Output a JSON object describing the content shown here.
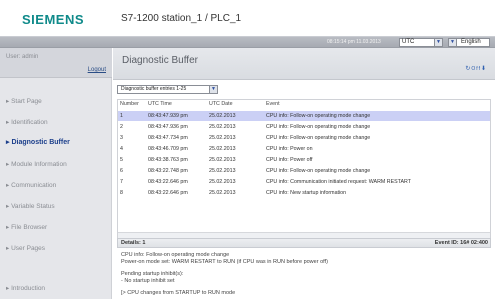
{
  "header": {
    "logo": "SIEMENS",
    "station": "S7-1200 station_1 / PLC_1"
  },
  "topbar": {
    "clock": "08:15:14 pm  11.03.2013",
    "timezone": "UTC",
    "language": "English"
  },
  "sidebar": {
    "user": "User: admin",
    "logout": "Logout",
    "items": [
      {
        "label": "Start Page"
      },
      {
        "label": "Identification"
      },
      {
        "label": "Diagnostic Buffer",
        "active": true
      },
      {
        "label": "Module Information"
      },
      {
        "label": "Communication"
      },
      {
        "label": "Variable Status"
      },
      {
        "label": "File Browser"
      },
      {
        "label": "User Pages"
      },
      {
        "label": "Introduction"
      }
    ]
  },
  "main": {
    "title": "Diagnostic Buffer",
    "filter": "Diagnostic buffer entries 1-25",
    "table": {
      "headers": [
        "Number",
        "UTC Time",
        "UTC Date",
        "Event"
      ],
      "rows": [
        [
          "1",
          "08:43:47.939 pm",
          "25.02.2013",
          "CPU info: Follow-on operating mode change"
        ],
        [
          "2",
          "08:43:47.936 pm",
          "25.02.2013",
          "CPU info: Follow-on operating mode change"
        ],
        [
          "3",
          "08:43:47.734 pm",
          "25.02.2013",
          "CPU info: Follow-on operating mode change"
        ],
        [
          "4",
          "08:43:46.709 pm",
          "25.02.2013",
          "CPU info: Power on"
        ],
        [
          "5",
          "08:43:38.763 pm",
          "25.02.2013",
          "CPU info: Power off"
        ],
        [
          "6",
          "08:43:22.748 pm",
          "25.02.2013",
          "CPU info: Follow-on operating mode change"
        ],
        [
          "7",
          "08:43:22.646 pm",
          "25.02.2013",
          "CPU info: Communication initiated request: WARM RESTART"
        ],
        [
          "8",
          "08:43:22.646 pm",
          "25.02.2013",
          "CPU info: New startup information"
        ]
      ]
    },
    "details_label": "Details: 1",
    "event_id": "Event ID: 16# 02:400",
    "details": [
      "CPU info: Follow-on operating mode change",
      "Power-on mode set: WARM RESTART to RUN (if CPU was in RUN before power off)",
      "Pending startup inhibit(s):",
      "- No startup inhibit set",
      "[> CPU changes from STARTUP to RUN mode"
    ]
  },
  "colors": {
    "brand": "#0f8a8a",
    "active_nav": "#1c3f8c",
    "selected_row": "#cbd0f5"
  }
}
